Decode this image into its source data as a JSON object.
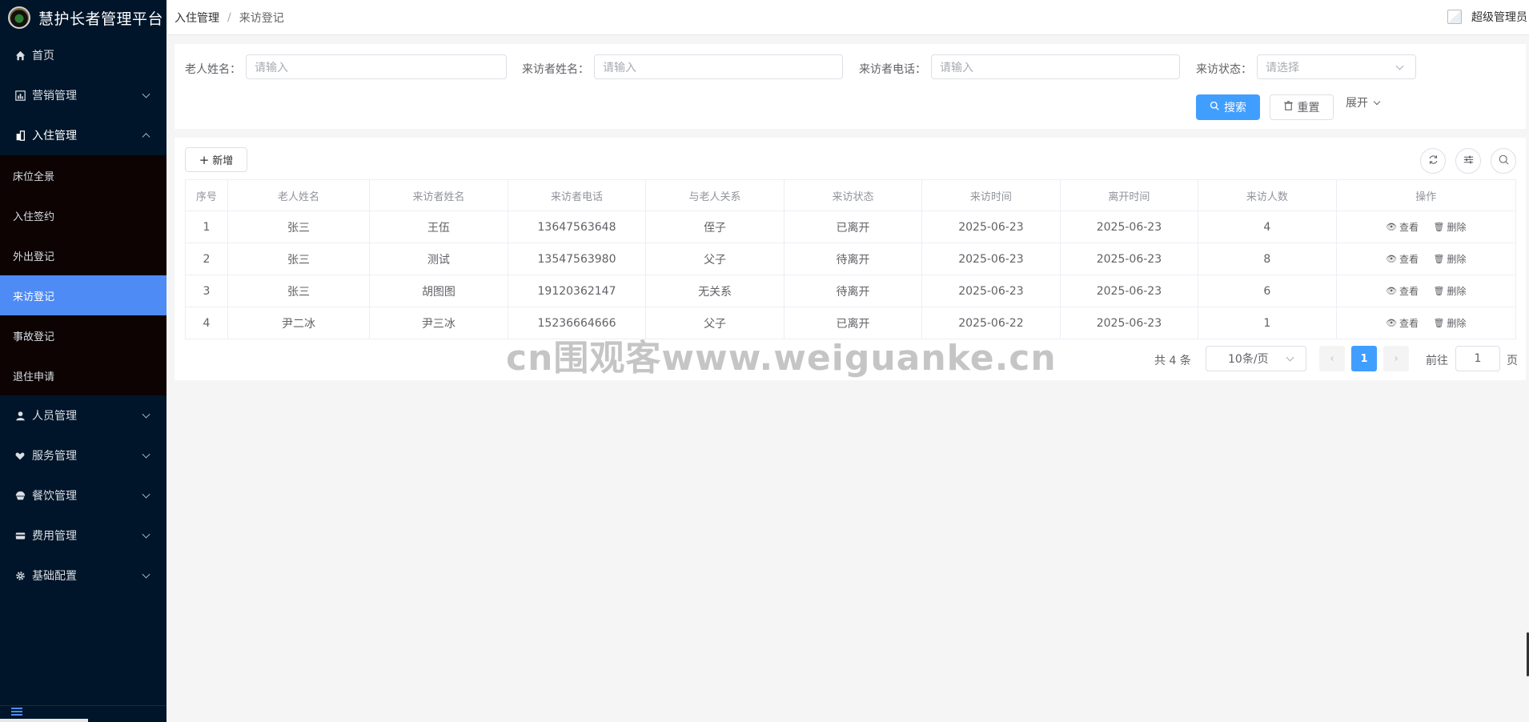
{
  "app": {
    "title": "慧护长者管理平台"
  },
  "sidebar": {
    "items": [
      {
        "label": "首页",
        "icon": "home-icon",
        "expandable": false
      },
      {
        "label": "营销管理",
        "icon": "chart-icon",
        "expandable": true
      },
      {
        "label": "入住管理",
        "icon": "building-icon",
        "expandable": true,
        "expanded": true
      },
      {
        "label": "人员管理",
        "icon": "user-icon",
        "expandable": true
      },
      {
        "label": "服务管理",
        "icon": "heart-hand-icon",
        "expandable": true
      },
      {
        "label": "餐饮管理",
        "icon": "bowl-icon",
        "expandable": true
      },
      {
        "label": "费用管理",
        "icon": "card-icon",
        "expandable": true
      },
      {
        "label": "基础配置",
        "icon": "gear-icon",
        "expandable": true
      }
    ],
    "submenu": [
      "床位全景",
      "入住签约",
      "外出登记",
      "来访登记",
      "事故登记",
      "退住申请"
    ],
    "active_sub": "来访登记"
  },
  "header": {
    "breadcrumb": [
      "入住管理",
      "来访登记"
    ],
    "breadcrumb_sep": "/",
    "user": "超级管理员"
  },
  "search": {
    "elder_name_label": "老人姓名：",
    "elder_name_placeholder": "请输入",
    "visitor_name_label": "来访者姓名：",
    "visitor_name_placeholder": "请输入",
    "visitor_phone_label": "来访者电话：",
    "visitor_phone_placeholder": "请输入",
    "status_label": "来访状态：",
    "status_placeholder": "请选择",
    "search_btn": "搜索",
    "reset_btn": "重置",
    "expand_link": "展开"
  },
  "toolbar": {
    "add_btn": "新增"
  },
  "table": {
    "columns": [
      "序号",
      "老人姓名",
      "来访者姓名",
      "来访者电话",
      "与老人关系",
      "来访状态",
      "来访时间",
      "离开时间",
      "来访人数",
      "操作"
    ],
    "rows": [
      [
        "1",
        "张三",
        "王伍",
        "13647563648",
        "侄子",
        "已离开",
        "2025-06-23",
        "2025-06-23",
        "4"
      ],
      [
        "2",
        "张三",
        "测试",
        "13547563980",
        "父子",
        "待离开",
        "2025-06-23",
        "2025-06-23",
        "8"
      ],
      [
        "3",
        "张三",
        "胡图图",
        "19120362147",
        "无关系",
        "待离开",
        "2025-06-23",
        "2025-06-23",
        "6"
      ],
      [
        "4",
        "尹二冰",
        "尹三冰",
        "15236664666",
        "父子",
        "已离开",
        "2025-06-22",
        "2025-06-23",
        "1"
      ]
    ],
    "actions": {
      "view": "查看",
      "delete": "删除"
    }
  },
  "pagination": {
    "total": "共 4 条",
    "page_size": "10条/页",
    "current": "1",
    "goto_label": "前往",
    "goto_value": "1",
    "unit": "页"
  },
  "watermark": "cn围观客www.weiguanke.cn",
  "colors": {
    "primary": "#409eff",
    "sidebar_bg": "#001529",
    "active_menu": "#4f8bf5"
  }
}
